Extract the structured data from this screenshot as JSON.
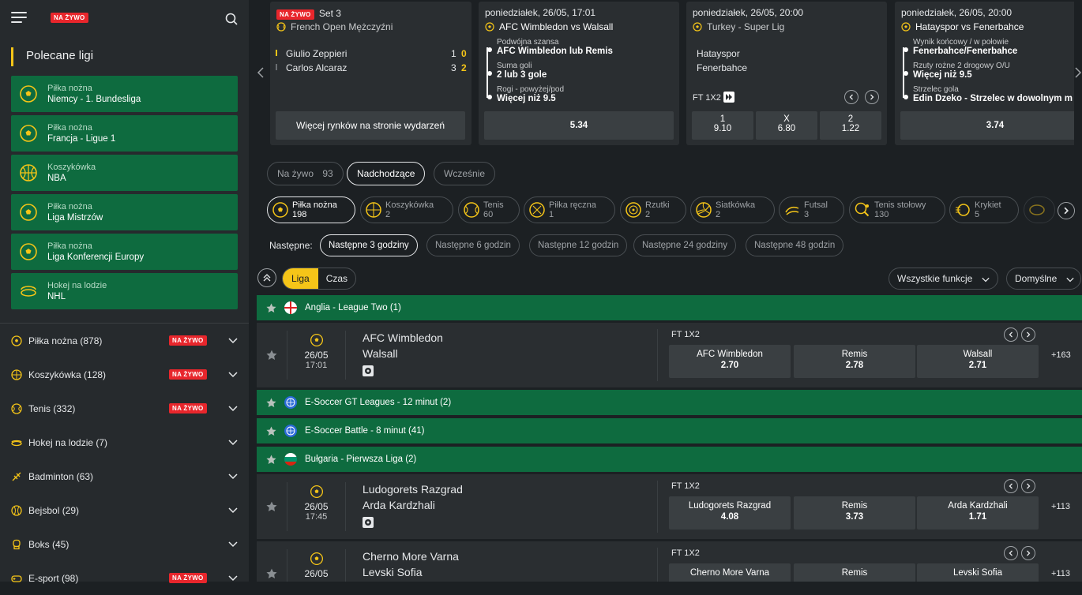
{
  "header": {
    "live_badge": "NA ŻYWO"
  },
  "sidebar": {
    "section_title": "Polecane ligi",
    "featured": [
      {
        "sport": "Piłka nożna",
        "league": "Niemcy - 1. Bundesliga",
        "icon": "football-icon"
      },
      {
        "sport": "Piłka nożna",
        "league": "Francja - Ligue 1",
        "icon": "football-icon"
      },
      {
        "sport": "Koszykówka",
        "league": "NBA",
        "icon": "basketball-icon"
      },
      {
        "sport": "Piłka nożna",
        "league": "Liga Mistrzów",
        "icon": "football-icon"
      },
      {
        "sport": "Piłka nożna",
        "league": "Liga Konferencji Europy",
        "icon": "football-icon"
      },
      {
        "sport": "Hokej na lodzie",
        "league": "NHL",
        "icon": "hockey-icon"
      }
    ],
    "sports": [
      {
        "label": "Piłka nożna  (878)",
        "live": "NA ŻYWO"
      },
      {
        "label": "Koszykówka  (128)",
        "live": "NA ŻYWO"
      },
      {
        "label": "Tenis  (332)",
        "live": "NA ŻYWO"
      },
      {
        "label": "Hokej na lodzie  (7)",
        "live": ""
      },
      {
        "label": "Badminton  (63)",
        "live": ""
      },
      {
        "label": "Bejsbol  (29)",
        "live": ""
      },
      {
        "label": "Boks  (45)",
        "live": ""
      },
      {
        "label": "E-sport  (98)",
        "live": "NA ŻYWO"
      }
    ]
  },
  "carousel": {
    "card1": {
      "live": "NA ŻYWO",
      "set": "Set 3",
      "tournament": "French Open Mężczyźni",
      "p1": "Giulio Zeppieri",
      "p1_sets": "1",
      "p1_games": "0",
      "p2": "Carlos Alcaraz",
      "p2_sets": "3",
      "p2_games": "2",
      "more": "Więcej rynków na stronie wydarzeń"
    },
    "card2": {
      "date": "poniedziałek, 26/05, 17:01",
      "match": "AFC Wimbledon vs Walsall",
      "l1": "Podwójna szansa",
      "v1": "AFC Wimbledon lub Remis",
      "l2": "Suma goli",
      "v2": "2 lub 3 gole",
      "l3": "Rogi - powyżej/pod",
      "v3": "Więcej niż 9.5",
      "odds": "5.34"
    },
    "card3": {
      "date": "poniedziałek, 26/05, 20:00",
      "league": "Turkey - Super Lig",
      "home": "Hatayspor",
      "away": "Fenerbahce",
      "market": "FT 1X2",
      "o1l": "1",
      "o1": "9.10",
      "oxl": "X",
      "ox": "6.80",
      "o2l": "2",
      "o2": "1.22"
    },
    "card4": {
      "date": "poniedziałek, 26/05, 20:00",
      "match": "Hatayspor vs Fenerbahce",
      "l1": "Wynik końcowy / w połowie",
      "v1": "Fenerbahce/Fenerbahce",
      "l2": "Rzuty rożne 2 drogowy O/U",
      "v2": "Więcej niż 9.5",
      "l3": "Strzelec gola",
      "v3": "Edin Dzeko - Strzelec w dowolnym m",
      "odds": "3.74"
    }
  },
  "filters": {
    "live": "Na żywo",
    "live_count": "93",
    "upcoming": "Nadchodzące",
    "earlier": "Wcześnie"
  },
  "sport_tabs": [
    {
      "name": "Piłka nożna",
      "count": "198"
    },
    {
      "name": "Koszykówka",
      "count": "2"
    },
    {
      "name": "Tenis",
      "count": "60"
    },
    {
      "name": "Piłka ręczna",
      "count": "1"
    },
    {
      "name": "Rzutki",
      "count": "2"
    },
    {
      "name": "Siatkówka",
      "count": "2"
    },
    {
      "name": "Futsal",
      "count": "3"
    },
    {
      "name": "Tenis stołowy",
      "count": "130"
    },
    {
      "name": "Krykiet",
      "count": "5"
    }
  ],
  "time_window": {
    "label": "Następne:",
    "options": [
      "Następne 3 godziny",
      "Następne 6 godzin",
      "Następne 12 godzin",
      "Następne 24 godziny",
      "Następne 48 godzin"
    ]
  },
  "toolbar": {
    "league": "Liga",
    "time": "Czas",
    "features": "Wszystkie funkcje",
    "sort": "Domyślne"
  },
  "leagues": [
    "Anglia - League Two (1)",
    "E-Soccer GT Leagues - 12 minut (2)",
    "E-Soccer Battle - 8 minut (41)",
    "Bułgaria - Pierwsza Liga (2)"
  ],
  "events": [
    {
      "date": "26/05",
      "time": "17:01",
      "home": "AFC Wimbledon",
      "away": "Walsall",
      "market": "FT 1X2",
      "o1n": "AFC Wimbledon",
      "o1": "2.70",
      "oxn": "Remis",
      "ox": "2.78",
      "o2n": "Walsall",
      "o2": "2.71",
      "more": "+163"
    },
    {
      "date": "26/05",
      "time": "17:45",
      "home": "Ludogorets Razgrad",
      "away": "Arda Kardzhali",
      "market": "FT 1X2",
      "o1n": "Ludogorets Razgrad",
      "o1": "4.08",
      "oxn": "Remis",
      "ox": "3.73",
      "o2n": "Arda Kardzhali",
      "o2": "1.71",
      "more": "+113"
    },
    {
      "date": "26/05",
      "home": "Cherno More Varna",
      "away": "Levski Sofia",
      "market": "FT 1X2",
      "o1n": "Cherno More Varna",
      "oxn": "Remis",
      "o2n": "Levski Sofia",
      "more": "+113"
    }
  ],
  "colors": {
    "accent": "#f5c518",
    "league_green": "#0e6b3f",
    "live_red": "#e8262c"
  }
}
